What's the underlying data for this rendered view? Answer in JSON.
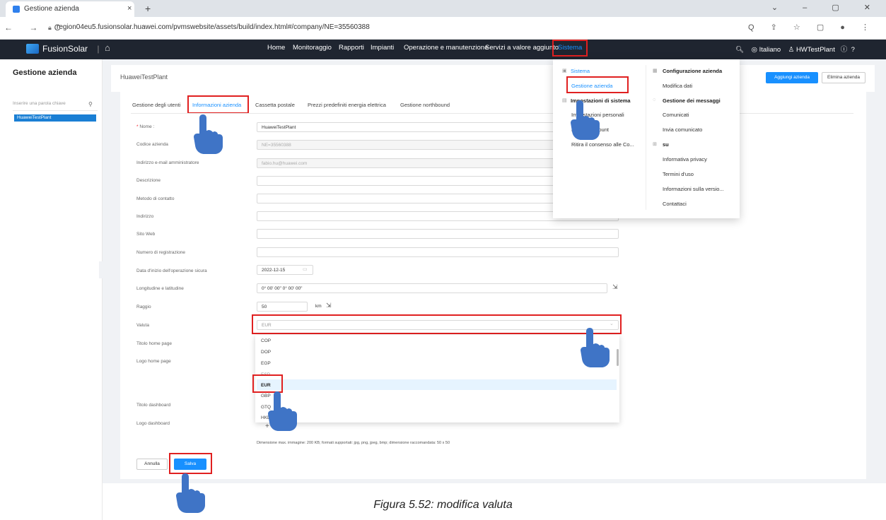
{
  "browser": {
    "tab_title": "Gestione azienda",
    "tab_close": "×",
    "new_tab": "+",
    "nav": "← → C",
    "url": "region04eu5.fusionsolar.huawei.com/pvmswebsite/assets/build/index.html#/company/NE=35560388",
    "window_controls": "⌄ – ▢ ✕",
    "addr_icons": "Q ⇪ ☆ ▢ ●  ⋮"
  },
  "header": {
    "brand": "FusionSolar",
    "separator": "|",
    "nav": [
      "Home",
      "Monitoraggio",
      "Rapporti",
      "Impianti",
      "Operazione e manutenzione",
      "Servizi a valore aggiunto",
      "Sistema"
    ],
    "language": "Italiano",
    "user": "HWTestPlant"
  },
  "sidebar": {
    "title": "Gestione azienda",
    "search_placeholder": "Inserire una parola chiave",
    "item": "HuaweiTestPlant"
  },
  "company": {
    "name": "HuaweiTestPlant",
    "add_button": "Aggiungi azienda",
    "delete_button": "Elimina azienda"
  },
  "tabs": [
    "Gestione degli utenti",
    "Informazioni azienda",
    "Cassetta postale",
    "Prezzi predefiniti energia elettrica",
    "Gestione northbound"
  ],
  "form": {
    "nome_label": "Nome",
    "nome_value": "HuaweiTestPlant",
    "codice_label": "Codice azienda",
    "codice_value": "NE=35560388",
    "email_label": "Indirizzo e-mail amministratore",
    "email_value": "fabio.hu@huawei.com",
    "descrizione_label": "Descrizione",
    "metodo_label": "Metodo di contatto",
    "indirizzo_label": "Indirizzo",
    "sito_label": "Sito Web",
    "registrazione_label": "Numero di registrazione",
    "data_label": "Data d'inizio dell'operazione sicura",
    "data_value": "2022-12-15",
    "coord_label": "Longitudine e latitudine",
    "coord_value": "0° 00' 00\" 0° 00' 00\"",
    "raggio_label": "Raggio",
    "raggio_value": "50",
    "raggio_unit": "km",
    "valuta_label": "Valuta",
    "valuta_value": "EUR",
    "titolo_home_label": "Titolo home page",
    "logo_home_label": "Logo home page",
    "titolo_dash_label": "Titolo dashboard",
    "logo_dash_label": "Logo dashboard",
    "upload_plus": "+",
    "upload_note": "Dimensione max. immagine: 200 KB; formati supportati: jpg, png, jpeg, bmp; dimensione raccomandata: 50 x 50",
    "cancel_button": "Annulla",
    "save_button": "Salva"
  },
  "currency_options": [
    "COP",
    "DOP",
    "EGP",
    "ESP",
    "EUR",
    "GBP",
    "GTQ",
    "HKD"
  ],
  "menu": {
    "sistema": "Sistema",
    "gestione_azienda": "Gestione azienda",
    "impostazioni": "Impostazioni di sistema",
    "impostazioni_personali": "Impostazioni personali",
    "account": "Elimina account",
    "ritira": "Ritira il consenso alle Co...",
    "configurazione": "Configurazione azienda",
    "modifica_dati": "Modifica dati",
    "gestione_messaggi": "Gestione dei messaggi",
    "comunicati": "Comunicati",
    "invia": "Invia comunicato",
    "su": "su",
    "privacy": "Informativa privacy",
    "termini": "Termini d'uso",
    "versione": "Informazioni sulla versio...",
    "contattaci": "Contattaci"
  },
  "caption": "Figura 5.52: modifica valuta",
  "colors": {
    "accent": "#1890ff",
    "header": "#1f2530",
    "highlight": "#e02020"
  }
}
